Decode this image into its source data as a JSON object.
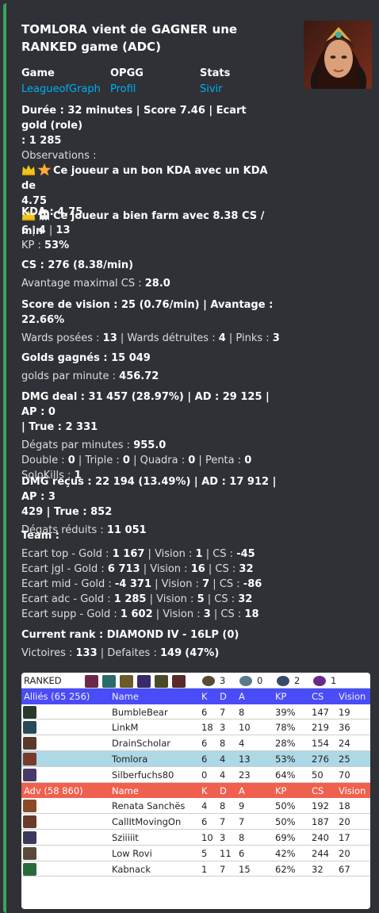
{
  "embed": {
    "title_parts": [
      "TOMLORA",
      "vient de",
      "GAGNER",
      "une",
      "RANKED game (ADC)"
    ],
    "accent": "#3ba55d",
    "thumbnail": "champion-portrait-samira"
  },
  "fields": [
    {
      "name": "Game",
      "value": "LeagueofGraph"
    },
    {
      "name": "OPGG",
      "value": "Profil"
    },
    {
      "name": "Stats",
      "value": "Sivir"
    }
  ],
  "summary": {
    "line1": "Durée : 32 minutes | Score 7.46 | Ecart gold (role)",
    "line2": ": 1 285",
    "obs_label": "Observations :",
    "obs1_a": "Ce joueur a un bon KDA avec un KDA de",
    "obs1_b": "4.75",
    "obs2": "Ce joueur a bien farm avec 8.38 CS / min",
    "obs1_icons": [
      "crown-icon",
      "star-icon"
    ],
    "obs2_icons": [
      "crown-icon",
      "ghost-icon"
    ]
  },
  "kda": {
    "title": "KDA : 4.75",
    "k": "6",
    "d": "4",
    "a": "13",
    "kp_label": "KP : ",
    "kp": "53%"
  },
  "cs": {
    "title": "CS : 276 (8.38/min)",
    "adv_label": "Avantage maximal CS : ",
    "adv": "28.0"
  },
  "vision": {
    "title1": "Score de vision : 25 (0.76/min) | Avantage :",
    "title2": "22.66%",
    "w1": "Wards posées : ",
    "w1v": "13",
    "w2": " | Wards détruites : ",
    "w2v": "4",
    "w3": " | Pinks : ",
    "w3v": "3"
  },
  "gold": {
    "title": "Golds gagnés : 15 049",
    "gpm_label": "golds par minute : ",
    "gpm": "456.72"
  },
  "dmg": {
    "title1": "DMG deal : 31 457 (28.97%) | AD : 29 125 | AP : 0",
    "title2": "| True : 2 331",
    "dpm_label": "Dégats par minutes : ",
    "dpm": "955.0",
    "double": "0",
    "triple": "0",
    "quadra": "0",
    "penta": "0",
    "solo": "1",
    "l_double": "Double : ",
    "l_triple": " | Triple : ",
    "l_quadra": " | Quadra : ",
    "l_penta": " | Penta : ",
    "l_solo": "SoloKills : "
  },
  "taken": {
    "title1": "DMG reçus : 22 194 (13.49%) | AD : 17 912 | AP : 3",
    "title2": "429 | True : 852",
    "red_label": "Dégats réduits : ",
    "red": "11 051"
  },
  "team": {
    "title": "Team :",
    "rows": [
      {
        "label": "Ecart top - Gold : ",
        "gold": "1 167",
        "vision": "1",
        "cs": "-45"
      },
      {
        "label": "Ecart jgl - Gold : ",
        "gold": "6 713",
        "vision": "16",
        "cs": "32"
      },
      {
        "label": "Ecart mid - Gold : ",
        "gold": "-4 371",
        "vision": "7",
        "cs": "-86"
      },
      {
        "label": "Ecart adc - Gold : ",
        "gold": "1 285",
        "vision": "5",
        "cs": "32"
      },
      {
        "label": "Ecart supp - Gold : ",
        "gold": "1 602",
        "vision": "3",
        "cs": "18"
      }
    ],
    "l_vision": " | Vision : ",
    "l_cs": " | CS : "
  },
  "rank": {
    "title": "Current rank : DIAMOND IV - 16LP (0)",
    "wins_label": "Victoires : ",
    "wins": "133",
    "losses_label": " | Defaites : ",
    "losses": "149",
    "pct": "(47%)"
  },
  "table": {
    "mode": "RANKED",
    "objectives": [
      {
        "icon": "dragon-icon",
        "value": "3"
      },
      {
        "icon": "herald-icon",
        "value": "0"
      },
      {
        "icon": "tower-icon",
        "value": "2"
      },
      {
        "icon": "baron-icon",
        "value": "1"
      }
    ],
    "headers": [
      "Name",
      "K",
      "D",
      "A",
      "KP",
      "CS",
      "Vision"
    ],
    "allies_label": "Alliés (65 256)",
    "enemies_label": "Adv (58 860)",
    "blue": "#4a4cf7",
    "red": "#f0604e",
    "highlight": "#add8e6",
    "allies": [
      {
        "name": "BumbleBear",
        "k": "6",
        "d": "7",
        "a": "8",
        "kp": "39%",
        "cs": "147",
        "vision": "19",
        "icon": "champion-icon"
      },
      {
        "name": "LinkM",
        "k": "18",
        "d": "3",
        "a": "10",
        "kp": "78%",
        "cs": "219",
        "vision": "36",
        "icon": "champion-icon"
      },
      {
        "name": "DrainScholar",
        "k": "6",
        "d": "8",
        "a": "4",
        "kp": "28%",
        "cs": "154",
        "vision": "24",
        "icon": "champion-icon"
      },
      {
        "name": "Tomlora",
        "k": "6",
        "d": "4",
        "a": "13",
        "kp": "53%",
        "cs": "276",
        "vision": "25",
        "icon": "champion-icon"
      },
      {
        "name": "Silberfuchs80",
        "k": "0",
        "d": "4",
        "a": "23",
        "kp": "64%",
        "cs": "50",
        "vision": "70",
        "icon": "champion-icon"
      }
    ],
    "enemies": [
      {
        "name": "Renata Sanchës",
        "k": "4",
        "d": "8",
        "a": "9",
        "kp": "50%",
        "cs": "192",
        "vision": "18",
        "icon": "champion-icon"
      },
      {
        "name": "CallItMovingOn",
        "k": "6",
        "d": "7",
        "a": "7",
        "kp": "50%",
        "cs": "187",
        "vision": "20",
        "icon": "champion-icon"
      },
      {
        "name": "Sziiiiit",
        "k": "10",
        "d": "3",
        "a": "8",
        "kp": "69%",
        "cs": "240",
        "vision": "17",
        "icon": "champion-icon"
      },
      {
        "name": "Low Rovi",
        "k": "5",
        "d": "11",
        "a": "6",
        "kp": "42%",
        "cs": "244",
        "vision": "20",
        "icon": "champion-icon"
      },
      {
        "name": "Kabnack",
        "k": "1",
        "d": "7",
        "a": "15",
        "kp": "62%",
        "cs": "32",
        "vision": "67",
        "icon": "champion-icon"
      }
    ]
  }
}
